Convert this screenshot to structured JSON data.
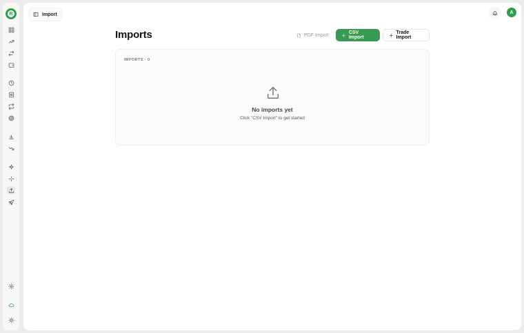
{
  "app": {
    "logo_letter": "R",
    "accent_color": "#3a9a52"
  },
  "sidebar": {
    "items": [
      {
        "icon": "dashboard-icon"
      },
      {
        "icon": "trending-up-icon"
      },
      {
        "icon": "transfer-icon"
      },
      {
        "icon": "wallet-icon"
      },
      {
        "icon": "history-icon"
      },
      {
        "icon": "report-icon"
      },
      {
        "icon": "repeat-icon"
      },
      {
        "icon": "target-icon"
      },
      {
        "icon": "bar-chart-icon"
      },
      {
        "icon": "trending-down-icon"
      },
      {
        "icon": "sparkles-icon"
      },
      {
        "icon": "activity-icon"
      },
      {
        "icon": "upload-icon",
        "active": true
      },
      {
        "icon": "rocket-icon"
      }
    ],
    "bottom": [
      {
        "icon": "settings-icon"
      },
      {
        "icon": "cloud-icon"
      },
      {
        "icon": "theme-sun-icon"
      }
    ]
  },
  "topbar": {
    "breadcrumb": "Import",
    "avatar_initial": "A"
  },
  "page": {
    "title": "Imports",
    "buttons": {
      "pdf": "PDF Import",
      "csv": "CSV Import",
      "trade": "Trade Import"
    },
    "panel": {
      "label": "IMPORTS · 0",
      "empty_title": "No imports yet",
      "empty_subtitle": "Click \"CSV Import\" to get started"
    }
  }
}
